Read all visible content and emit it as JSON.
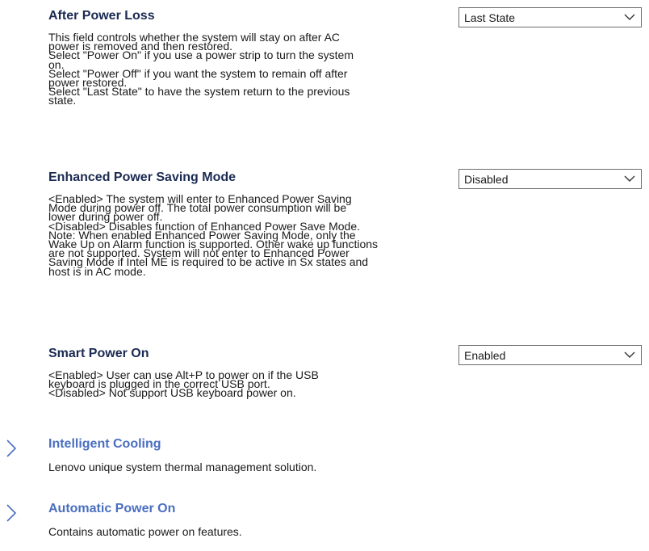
{
  "settings": [
    {
      "title": "After Power Loss",
      "value": "Last State",
      "description": [
        "This field controls whether the system will stay on after AC",
        "power is removed and then restored.",
        "Select \"Power On\" if you use a power strip to turn the system",
        "on.",
        "Select \"Power Off\" if you want the system to remain off after",
        "power restored.",
        "Select \"Last State\" to have the system return to the previous",
        "state."
      ]
    },
    {
      "title": "Enhanced Power Saving Mode",
      "value": "Disabled",
      "description": [
        "<Enabled> The system will enter to Enhanced Power Saving",
        "Mode during power off. The total power consumption will be",
        "lower during power off.",
        "<Disabled> Disables function of Enhanced Power Save Mode.",
        "Note: When enabled Enhanced Power Saving Mode, only the",
        "Wake Up on Alarm function is supported. Other wake up functions",
        "are not supported. System will not enter to Enhanced Power",
        "Saving Mode if Intel ME is required to be active in Sx states and",
        "host is in AC mode."
      ]
    },
    {
      "title": "Smart Power On",
      "value": "Enabled",
      "description": [
        "<Enabled> User can use Alt+P to power on if the USB",
        "keyboard is plugged in the correct USB port.",
        "<Disabled> Not support USB keyboard power on."
      ]
    }
  ],
  "nav_items": [
    {
      "title": "Intelligent Cooling",
      "description": "Lenovo unique system thermal management solution."
    },
    {
      "title": "Automatic Power On",
      "description": "Contains automatic power on features."
    }
  ],
  "colors": {
    "setting_title": "#1b2a52",
    "nav_title": "#4a6fc0",
    "chevron": "#4a6fc0",
    "body_text": "#1a1a1a"
  }
}
